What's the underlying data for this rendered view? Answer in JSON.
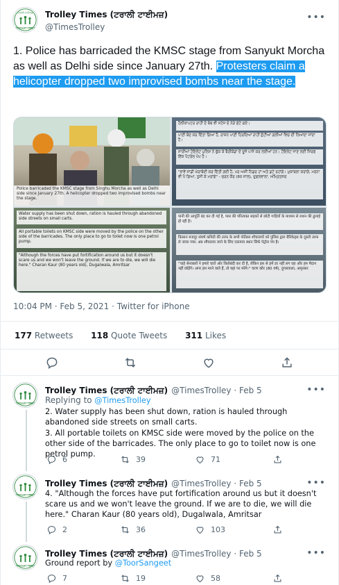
{
  "tweet": {
    "author_name": "Trolley Times (ਟਰਾਲੀ ਟਾਈਮਜ਼)",
    "author_handle": "@TimesTrolley",
    "text_plain": "1. Police has barricaded the KMSC stage from Sanyukt Morcha as well as Delhi side since January 27th.",
    "text_highlighted": "Protesters claim a helicopter dropped two improvised bombs near the stage.",
    "timestamp": "10:04 PM · Feb 5, 2021 · Twitter for iPhone",
    "retweets_count": "177",
    "retweets_label": "Retweets",
    "quotes_count": "118",
    "quotes_label": "Quote Tweets",
    "likes_count": "311",
    "likes_label": "Likes"
  },
  "media": {
    "captions": [
      "Police barricaded the KMSC stage from Singhu Morcha as well as Delhi side since January 27th. A helicopter dropped two improvised bombs near the stage.",
      "Water supply has been shut down, ration is hauled through abandoned side streets on small carts.",
      "All portable toilets on KMSC side were moved by the police on the other side of the barricades. The only place to go to toilet now is one petrol pump.",
      "\"Although the forces have put fortification around us but it doesn't scare us and we won't leave the ground. If we are to die, we will die here.\" Charan Kaur (80 years old), Dugalwala, Amritsar"
    ],
    "punjabi_lines": [
      "ਹੈਲੀਕਾਪਟਰ ਰਾਹੀਂ ਦੋ ਬੰਬ ਵੀ ਸਟੇਜ ਦੇ ਨੇੜੇ ਸੁੱਟੇ ਗਏ।",
      "ਪਾਣੀ ਬੰਦ ਕਰ ਦਿੱਤਾ ਗਿਆ ਹੈ, ਰਾਸ਼ਨ ਪਾਣੀ ਹਿਰਦਿਆਂ ਰਾਹੀਂ ਛੋਟੀਆਂ ਗਲੀਆਂ ਵਿਚ ਦੀ ਲਿਆਂਦਾ ਜਾਂਦਾ ਹੈ।",
      "ਸਾਰੀਆਂ ਟੋਇਲੇਟ ਪੁਲਿਸ ਨੇ ਚੁੱਕ ਕੇ ਬੈਰੀਕੇਡਾਂ ਦੇ ਦੂਜੇ ਪਾਸੇ ਕਰ ਲਈਆਂ ਹਨ। ਟੋਇਲੇਟ ਜਾਣ ਲਈ ਸਿਰਫ ਇੱਕ ਪੈਟਰੋਲ ਪੰਪ ਹੈ।",
      "\"ਭਾਵੇਂ ਸਾਡੀ ਘੇਰਾਬੰਦੀ ਕਰ ਦਿੱਤੀ ਗਈ ਹੈ, ਪਰ ਅਸੀਂ ਨਿਡਰ ਹਾਂ ਅਤੇ ਡਟੇ ਰਹਾਂਗੇ। ਮੁਕਾਬਲਾ ਕਰਾਂਗੇ, ਮਰਨਾ ਵੀ ਪੈ ਗਿਆ, ਤੁਸੀ ਕੇ ਮਰਾਂਗੇ\" - ਚਰਨ ਕੌਰ (80 ਸਾਲ), ਦੁਗਲਵਾਲਾ, ਅੰਮ੍ਰਿਤਸਰ"
    ],
    "hindi_lines": [
      "पानी की आपूर्ति बंद कर दी गई है, पास की परित्यक्त सड़कों से छोटी गाड़ियों के माध्यम से राशन की ढुलाई हो रही है।",
      "किसान मजदूर संघर्ष कमिटी की तरफ के सभी पोर्टेबल शौचालयों को पुलिस द्वारा बैरिकेड्स के दूसरी तरफ ले जाया गया। अब शौचालय जाने के लिए एकमात्र स्थान सिर्फ पेट्रोल पंप है।",
      "\"चाहे सेनाबलों ने हमारे चारों ओर किलेबंदी कर दी है, लेकिन इस से हमें डर नहीं लग रहा और हम मैदान नहीं छोड़ेंगे। अगर हम मरने वाले हैं, तो यहां पर मरेंगे।\" चरण कौर (80 वर्ष), दुगलवाला, अमृतसर"
    ]
  },
  "replies": [
    {
      "author_name": "Trolley Times (ਟਰਾਲੀ ਟਾਈਮਜ਼)",
      "handle_date": "@TimesTrolley · Feb 5",
      "replying_prefix": "Replying to",
      "replying_to": "@TimesTrolley",
      "text_1": "2. Water supply has been shut down, ration is hauled through abandoned side streets on small carts.",
      "text_2": "3. All portable toilets on KMSC side were moved by the police on the other side of the barricades. The only place to go to toilet now is one petrol pump.",
      "replies_count": "6",
      "retweets_count": "39",
      "likes_count": "71"
    },
    {
      "author_name": "Trolley Times (ਟਰਾਲੀ ਟਾਈਮਜ਼)",
      "handle_date": "@TimesTrolley · Feb 5",
      "text_1": "4. \"Although the forces have put fortification around us but it doesn't scare us and we won't leave the ground. If we are to die, we will die here.\" Charan Kaur (80 years old), Dugalwala, Amritsar",
      "replies_count": "2",
      "retweets_count": "36",
      "likes_count": "103"
    },
    {
      "author_name": "Trolley Times (ਟਰਾਲੀ ਟਾਈਮਜ਼)",
      "handle_date": "@TimesTrolley · Feb 5",
      "text_prefix": "Ground report by",
      "mention": "@ToorSangeet",
      "replies_count": "7",
      "retweets_count": "19",
      "likes_count": "58"
    }
  ],
  "avatar_text": "TROLLEY TIMES",
  "colors": {
    "accent": "#1d9bf0",
    "text": "#0f1419",
    "muted": "#536471",
    "border": "#e6ecf0",
    "logo_green": "#2e8b3e"
  },
  "icons": [
    "more-icon",
    "reply-icon",
    "retweet-icon",
    "like-icon",
    "share-icon"
  ]
}
